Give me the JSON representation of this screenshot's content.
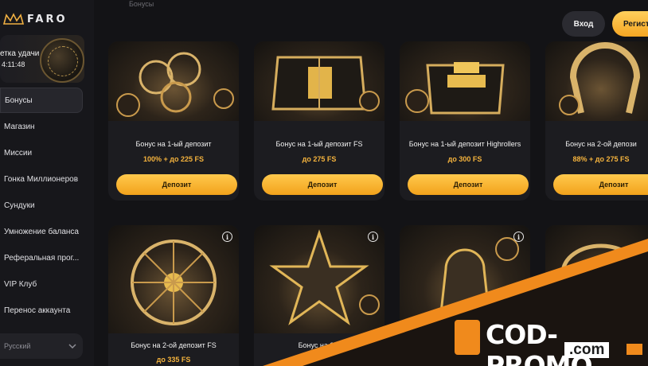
{
  "brand": {
    "name": "FARO"
  },
  "wheel": {
    "title": "етка удачи",
    "timer": "4:11:48"
  },
  "sidebar": {
    "items": [
      {
        "label": "Бонусы",
        "active": true
      },
      {
        "label": "Магазин"
      },
      {
        "label": "Миссии"
      },
      {
        "label": "Гонка Миллионеров"
      },
      {
        "label": "Сундуки"
      },
      {
        "label": "Умножение баланса"
      },
      {
        "label": "Реферальная прог..."
      },
      {
        "label": "VIP Клуб"
      },
      {
        "label": "Перенос аккаунта"
      }
    ],
    "language": "Русский"
  },
  "header": {
    "hint": "Бонусы",
    "login_label": "Вход",
    "register_label": "Регистр"
  },
  "bonuses": [
    {
      "title": "Бонус на 1-ый депозит",
      "subtitle": "100% + до 225 FS",
      "button": "Депозит",
      "image": "clover"
    },
    {
      "title": "Бонус на 1-ый депозит FS",
      "subtitle": "до 275 FS",
      "button": "Депозит",
      "image": "chest"
    },
    {
      "title": "Бонус на 1-ый депозит Highrollers",
      "subtitle": "до 300 FS",
      "button": "Депозит",
      "image": "gold-bars"
    },
    {
      "title": "Бонус на 2-ой депози",
      "subtitle": "88% + до 275 FS",
      "button": "Депозит",
      "image": "horseshoe"
    },
    {
      "title": "Бонус на 2-ой депозит FS",
      "subtitle": "до 335 FS",
      "image": "wheel"
    },
    {
      "title": "Бонус на 2-о",
      "subtitle": "",
      "image": "star"
    },
    {
      "title": "",
      "subtitle": "",
      "image": "bell"
    },
    {
      "title": "",
      "subtitle": "",
      "image": "ring"
    }
  ],
  "watermark": {
    "main": "COD-PROMO",
    "sub": ".com"
  },
  "colors": {
    "accent": "#f5a623",
    "bg": "#131316",
    "card": "#1c1c20",
    "promo_banner": "#f08a1c"
  }
}
